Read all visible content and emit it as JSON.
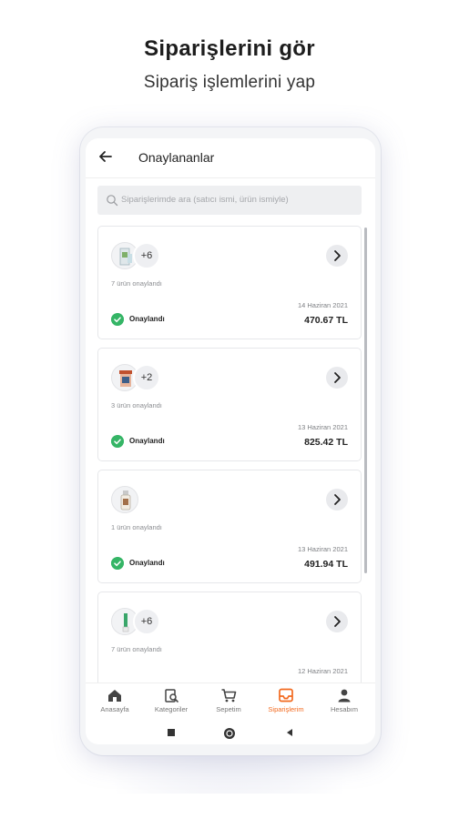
{
  "hero": {
    "title": "Siparişlerini gör",
    "subtitle": "Sipariş işlemlerini yap"
  },
  "appbar": {
    "back_icon": "arrow-left-icon",
    "title": "Onaylananlar"
  },
  "search": {
    "placeholder": "Siparişlerimde ara (satıcı ismi, ürün ismiyle)"
  },
  "orders": [
    {
      "more": "+6",
      "count_text": "7 ürün onaylandı",
      "date": "14 Haziran 2021",
      "amount": "470.67 TL",
      "status": "Onaylandı"
    },
    {
      "more": "+2",
      "count_text": "3 ürün onaylandı",
      "date": "13 Haziran 2021",
      "amount": "825.42 TL",
      "status": "Onaylandı"
    },
    {
      "more": "",
      "count_text": "1 ürün onaylandı",
      "date": "13 Haziran 2021",
      "amount": "491.94 TL",
      "status": "Onaylandı"
    },
    {
      "more": "+6",
      "count_text": "7 ürün onaylandı",
      "date": "12 Haziran 2021",
      "amount": "",
      "status": ""
    }
  ],
  "bottom_nav": {
    "items": [
      {
        "label": "Anasayfa",
        "icon": "home-icon"
      },
      {
        "label": "Kategoriler",
        "icon": "category-search-icon"
      },
      {
        "label": "Sepetim",
        "icon": "cart-icon"
      },
      {
        "label": "Siparişlerim",
        "icon": "orders-tray-icon",
        "active": true
      },
      {
        "label": "Hesabım",
        "icon": "person-icon"
      }
    ]
  },
  "colors": {
    "accent": "#f26a1f",
    "success": "#35b566"
  }
}
